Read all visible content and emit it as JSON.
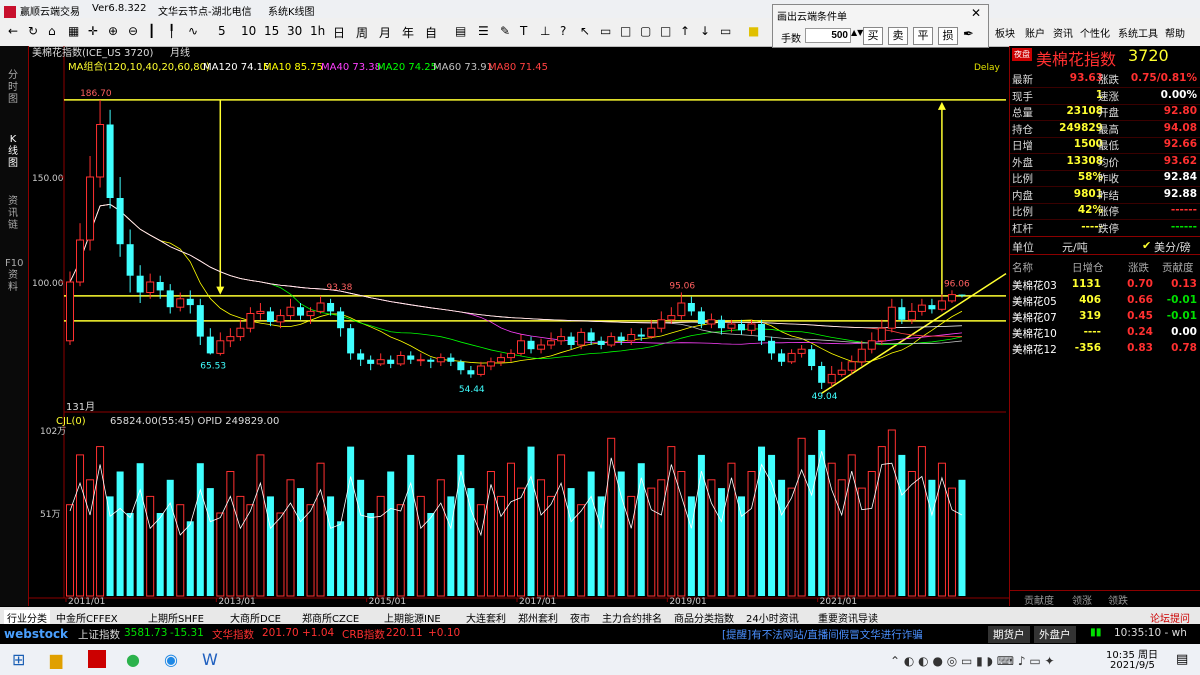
{
  "window": {
    "app_name": "赢顺云端交易",
    "version": "Ver6.8.322",
    "node": "文华云节点-湖北电信",
    "view": "系统K线图"
  },
  "toolbar": {
    "periods": [
      "5",
      "10",
      "15",
      "30",
      "1h",
      "日",
      "周",
      "月",
      "年",
      "自"
    ],
    "right_menu": [
      "板块",
      "账户",
      "资讯",
      "个性化",
      "系统工具",
      "帮助"
    ]
  },
  "dialog": {
    "title": "画出云端条件单",
    "qty_label": "手数",
    "qty_value": "500",
    "buttons": [
      "买",
      "卖",
      "平",
      "损"
    ]
  },
  "left_tabs": [
    "分时图",
    "K线图",
    "资讯链",
    "F10资料"
  ],
  "chart_header": {
    "symbol": "美棉花指数(ICE_US 3720)",
    "period": "月线",
    "ma_group": "MA组合(120,10,40,20,60,80)",
    "ma_entries": [
      {
        "label": "MA120 74.15",
        "color": "#ffffff"
      },
      {
        "label": "MA10 85.75",
        "color": "#ffff00"
      },
      {
        "label": "MA40 73.38",
        "color": "#ff40ff"
      },
      {
        "label": "MA20 74.25",
        "color": "#00ff00"
      },
      {
        "label": "MA60 73.91",
        "color": "#c0c0c0"
      },
      {
        "label": "MA80 71.45",
        "color": "#ff4040"
      }
    ],
    "delay_label": "Delay",
    "bars_count": "131月"
  },
  "vol_header": {
    "label": "CJL(0)",
    "values": "65824.00(55:45)  OPID 249829.00"
  },
  "chart_data": {
    "type": "candlestick",
    "x_ticks": [
      "2011/01",
      "2013/01",
      "2015/01",
      "2017/01",
      "2019/01",
      "2021/01"
    ],
    "y_ticks": [
      "150.00",
      "100.00"
    ],
    "vol_y_ticks": [
      "102万",
      "51万"
    ],
    "ylim": [
      40,
      200
    ],
    "annotations": [
      "186.70",
      "93.38",
      "65.53",
      "54.44",
      "95.06",
      "49.04",
      "96.06"
    ],
    "horizontal_lines": [
      186.7,
      93.4,
      81.5
    ],
    "candles": [
      {
        "o": 72,
        "c": 100,
        "h": 105,
        "l": 70
      },
      {
        "o": 100,
        "c": 120,
        "h": 128,
        "l": 98
      },
      {
        "o": 120,
        "c": 150,
        "h": 160,
        "l": 115
      },
      {
        "o": 150,
        "c": 175,
        "h": 186.7,
        "l": 145
      },
      {
        "o": 175,
        "c": 140,
        "h": 182,
        "l": 135
      },
      {
        "o": 140,
        "c": 118,
        "h": 150,
        "l": 112
      },
      {
        "o": 118,
        "c": 103,
        "h": 125,
        "l": 95
      },
      {
        "o": 103,
        "c": 95,
        "h": 108,
        "l": 90
      },
      {
        "o": 95,
        "c": 100,
        "h": 104,
        "l": 92
      },
      {
        "o": 100,
        "c": 96,
        "h": 103,
        "l": 92
      },
      {
        "o": 96,
        "c": 88,
        "h": 99,
        "l": 85
      },
      {
        "o": 88,
        "c": 92,
        "h": 95,
        "l": 86
      },
      {
        "o": 92,
        "c": 89,
        "h": 96,
        "l": 85
      },
      {
        "o": 89,
        "c": 74,
        "h": 92,
        "l": 70
      },
      {
        "o": 74,
        "c": 66,
        "h": 78,
        "l": 65.5
      },
      {
        "o": 66,
        "c": 72,
        "h": 76,
        "l": 65
      },
      {
        "o": 72,
        "c": 74,
        "h": 78,
        "l": 69
      },
      {
        "o": 74,
        "c": 78,
        "h": 82,
        "l": 72
      },
      {
        "o": 78,
        "c": 85,
        "h": 88,
        "l": 76
      },
      {
        "o": 85,
        "c": 86,
        "h": 90,
        "l": 82
      },
      {
        "o": 86,
        "c": 81,
        "h": 88,
        "l": 79
      },
      {
        "o": 81,
        "c": 84,
        "h": 87,
        "l": 78
      },
      {
        "o": 84,
        "c": 88,
        "h": 92,
        "l": 82
      },
      {
        "o": 88,
        "c": 84,
        "h": 90,
        "l": 82
      },
      {
        "o": 84,
        "c": 86,
        "h": 88,
        "l": 80
      },
      {
        "o": 86,
        "c": 90,
        "h": 93.4,
        "l": 85
      },
      {
        "o": 90,
        "c": 86,
        "h": 92,
        "l": 84
      },
      {
        "o": 86,
        "c": 78,
        "h": 88,
        "l": 74
      },
      {
        "o": 78,
        "c": 66,
        "h": 80,
        "l": 63
      },
      {
        "o": 66,
        "c": 63,
        "h": 68,
        "l": 60
      },
      {
        "o": 63,
        "c": 61,
        "h": 65,
        "l": 58
      },
      {
        "o": 61,
        "c": 63,
        "h": 66,
        "l": 60
      },
      {
        "o": 63,
        "c": 61,
        "h": 65,
        "l": 59
      },
      {
        "o": 61,
        "c": 65,
        "h": 67,
        "l": 60
      },
      {
        "o": 65,
        "c": 63,
        "h": 67,
        "l": 61
      },
      {
        "o": 63,
        "c": 63,
        "h": 66,
        "l": 60
      },
      {
        "o": 63,
        "c": 62,
        "h": 64,
        "l": 59
      },
      {
        "o": 62,
        "c": 64,
        "h": 66,
        "l": 60
      },
      {
        "o": 64,
        "c": 62,
        "h": 66,
        "l": 60
      },
      {
        "o": 62,
        "c": 58,
        "h": 63,
        "l": 56
      },
      {
        "o": 58,
        "c": 56,
        "h": 60,
        "l": 54.4
      },
      {
        "o": 56,
        "c": 60,
        "h": 62,
        "l": 55
      },
      {
        "o": 60,
        "c": 62,
        "h": 64,
        "l": 58
      },
      {
        "o": 62,
        "c": 64,
        "h": 66,
        "l": 60
      },
      {
        "o": 64,
        "c": 66,
        "h": 68,
        "l": 62
      },
      {
        "o": 66,
        "c": 72,
        "h": 75,
        "l": 65
      },
      {
        "o": 72,
        "c": 68,
        "h": 74,
        "l": 66
      },
      {
        "o": 68,
        "c": 70,
        "h": 73,
        "l": 66
      },
      {
        "o": 70,
        "c": 72,
        "h": 76,
        "l": 68
      },
      {
        "o": 72,
        "c": 74,
        "h": 78,
        "l": 70
      },
      {
        "o": 74,
        "c": 70,
        "h": 76,
        "l": 68
      },
      {
        "o": 70,
        "c": 76,
        "h": 78,
        "l": 68
      },
      {
        "o": 76,
        "c": 72,
        "h": 78,
        "l": 70
      },
      {
        "o": 72,
        "c": 70,
        "h": 74,
        "l": 68
      },
      {
        "o": 70,
        "c": 74,
        "h": 76,
        "l": 69
      },
      {
        "o": 74,
        "c": 72,
        "h": 76,
        "l": 70
      },
      {
        "o": 72,
        "c": 75,
        "h": 78,
        "l": 70
      },
      {
        "o": 75,
        "c": 74,
        "h": 78,
        "l": 72
      },
      {
        "o": 74,
        "c": 78,
        "h": 82,
        "l": 73
      },
      {
        "o": 78,
        "c": 82,
        "h": 86,
        "l": 76
      },
      {
        "o": 82,
        "c": 84,
        "h": 88,
        "l": 80
      },
      {
        "o": 84,
        "c": 90,
        "h": 95.06,
        "l": 82
      },
      {
        "o": 90,
        "c": 86,
        "h": 93,
        "l": 84
      },
      {
        "o": 86,
        "c": 80,
        "h": 88,
        "l": 78
      },
      {
        "o": 80,
        "c": 82,
        "h": 85,
        "l": 78
      },
      {
        "o": 82,
        "c": 78,
        "h": 84,
        "l": 75
      },
      {
        "o": 78,
        "c": 80,
        "h": 82,
        "l": 76
      },
      {
        "o": 80,
        "c": 77,
        "h": 82,
        "l": 75
      },
      {
        "o": 77,
        "c": 80,
        "h": 82,
        "l": 75
      },
      {
        "o": 80,
        "c": 72,
        "h": 82,
        "l": 70
      },
      {
        "o": 72,
        "c": 66,
        "h": 74,
        "l": 63
      },
      {
        "o": 66,
        "c": 62,
        "h": 68,
        "l": 60
      },
      {
        "o": 62,
        "c": 66,
        "h": 68,
        "l": 61
      },
      {
        "o": 66,
        "c": 68,
        "h": 70,
        "l": 64
      },
      {
        "o": 68,
        "c": 60,
        "h": 70,
        "l": 58
      },
      {
        "o": 60,
        "c": 52,
        "h": 62,
        "l": 49.04
      },
      {
        "o": 52,
        "c": 56,
        "h": 60,
        "l": 50
      },
      {
        "o": 56,
        "c": 58,
        "h": 62,
        "l": 55
      },
      {
        "o": 58,
        "c": 62,
        "h": 65,
        "l": 56
      },
      {
        "o": 62,
        "c": 68,
        "h": 72,
        "l": 60
      },
      {
        "o": 68,
        "c": 72,
        "h": 76,
        "l": 66
      },
      {
        "o": 72,
        "c": 78,
        "h": 82,
        "l": 70
      },
      {
        "o": 78,
        "c": 88,
        "h": 92,
        "l": 76
      },
      {
        "o": 88,
        "c": 82,
        "h": 92,
        "l": 80
      },
      {
        "o": 82,
        "c": 86,
        "h": 90,
        "l": 80
      },
      {
        "o": 86,
        "c": 89,
        "h": 92,
        "l": 84
      },
      {
        "o": 89,
        "c": 87,
        "h": 92,
        "l": 85
      },
      {
        "o": 87,
        "c": 91,
        "h": 94,
        "l": 86
      },
      {
        "o": 91,
        "c": 94,
        "h": 96.06,
        "l": 90
      },
      {
        "o": 94,
        "c": 93.63,
        "h": 94.08,
        "l": 92.66
      }
    ],
    "volumes": [
      0.55,
      0.85,
      0.7,
      0.9,
      0.6,
      0.75,
      0.5,
      0.8,
      0.6,
      0.5,
      0.7,
      0.55,
      0.45,
      0.8,
      0.65,
      0.5,
      0.75,
      0.6,
      0.55,
      0.85,
      0.6,
      0.5,
      0.7,
      0.65,
      0.55,
      0.8,
      0.6,
      0.45,
      0.9,
      0.7,
      0.5,
      0.6,
      0.75,
      0.55,
      0.85,
      0.6,
      0.5,
      0.7,
      0.6,
      0.85,
      0.65,
      0.55,
      0.75,
      0.6,
      0.8,
      0.65,
      0.9,
      0.7,
      0.6,
      0.85,
      0.65,
      0.55,
      0.75,
      0.6,
      0.95,
      0.75,
      0.6,
      0.8,
      0.65,
      0.7,
      0.9,
      0.75,
      0.6,
      0.85,
      0.7,
      0.65,
      0.8,
      0.6,
      0.75,
      0.9,
      0.85,
      0.7,
      0.65,
      0.95,
      0.85,
      1.0,
      0.8,
      0.7,
      0.85,
      0.65,
      0.75,
      0.9,
      1.0,
      0.85,
      0.75,
      0.9,
      0.7,
      0.8,
      0.65,
      0.7,
      0.05
    ]
  },
  "quote": {
    "title": "美棉花指数",
    "code": "3720",
    "rows": [
      {
        "l1": "最新",
        "v1": "93.63",
        "c1": "red",
        "l2": "涨跌",
        "v2": "0.75/0.81%",
        "c2": "red"
      },
      {
        "l1": "现手",
        "v1": "1",
        "c1": "yel",
        "l2": "速涨",
        "v2": "0.00%",
        "c2": "wht"
      },
      {
        "l1": "总量",
        "v1": "23108",
        "c1": "yel",
        "l2": "开盘",
        "v2": "92.80",
        "c2": "red"
      },
      {
        "l1": "持仓",
        "v1": "249829",
        "c1": "yel",
        "l2": "最高",
        "v2": "94.08",
        "c2": "red"
      },
      {
        "l1": "日增",
        "v1": "1500",
        "c1": "yel",
        "l2": "最低",
        "v2": "92.66",
        "c2": "red"
      },
      {
        "l1": "外盘",
        "v1": "13308",
        "c1": "yel",
        "l2": "均价",
        "v2": "93.62",
        "c2": "red"
      },
      {
        "l1": "比例",
        "v1": "58%",
        "c1": "yel",
        "l2": "昨收",
        "v2": "92.84",
        "c2": "wht"
      },
      {
        "l1": "内盘",
        "v1": "9801",
        "c1": "yel",
        "l2": "昨结",
        "v2": "92.88",
        "c2": "wht"
      },
      {
        "l1": "比例",
        "v1": "42%",
        "c1": "yel",
        "l2": "涨停",
        "v2": "------",
        "c2": "red"
      },
      {
        "l1": "杠杆",
        "v1": "-----",
        "c1": "yel",
        "l2": "跌停",
        "v2": "------",
        "c2": "grn"
      }
    ],
    "unit_label": "单位",
    "unit_value": "元/吨",
    "unit_alt": "美分/磅",
    "related_headers": [
      "名称",
      "日增仓",
      "涨跌",
      "贡献度"
    ],
    "related": [
      {
        "name": "美棉花03",
        "oi": "1131",
        "chg": "0.70",
        "contrib": "0.13",
        "cc": "red"
      },
      {
        "name": "美棉花05",
        "oi": "406",
        "chg": "0.66",
        "contrib": "-0.01",
        "cc": "grn"
      },
      {
        "name": "美棉花07",
        "oi": "319",
        "chg": "0.45",
        "contrib": "-0.01",
        "cc": "grn"
      },
      {
        "name": "美棉花10",
        "oi": "----",
        "chg": "0.24",
        "contrib": "0.00",
        "cc": "wht"
      },
      {
        "name": "美棉花12",
        "oi": "-356",
        "chg": "0.83",
        "contrib": "0.78",
        "cc": "red"
      }
    ],
    "bottom_tabs": [
      "贡献度",
      "领涨",
      "领跌"
    ]
  },
  "bottom_tabs": [
    "行业分类",
    "中金所CFFEX",
    "上期所SHFE",
    "大商所DCE",
    "郑商所CZCE",
    "上期能源INE",
    "大连套利",
    "郑州套利",
    "夜市",
    "主力合约排名",
    "商品分类指数",
    "24小时资讯",
    "重要资讯导读"
  ],
  "forum_label": "论坛提问",
  "status": {
    "brand": "webstock",
    "items": [
      {
        "name": "上证指数",
        "val": "3581.73",
        "chg": "-15.31"
      },
      {
        "name": "文华指数",
        "val": "201.70",
        "chg": "+1.04"
      },
      {
        "name": "CRB指数",
        "val": "220.11",
        "chg": "+0.10"
      }
    ],
    "ticker": "[提醒]有不法网站/直播间假冒文华进行诈骗",
    "btn1": "期货户",
    "btn2": "外盘户",
    "clock": "10:35:10 - wh"
  },
  "taskbar": {
    "time": "10:35 周日",
    "date": "2021/9/5"
  }
}
